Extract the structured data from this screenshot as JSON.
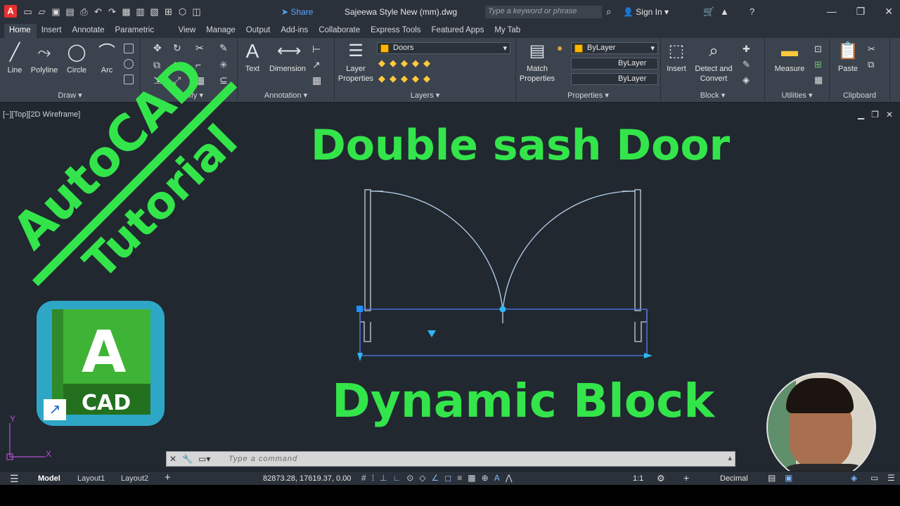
{
  "titlebar": {
    "app_logo": "A",
    "share_label": "Share",
    "document_title": "Sajeewa Style New (mm).dwg",
    "search_placeholder": "Type a keyword or phrase",
    "signin_label": "Sign In"
  },
  "ribbon_tabs": [
    "Home",
    "Insert",
    "Annotate",
    "Parametric",
    "View",
    "Manage",
    "Output",
    "Add-ins",
    "Collaborate",
    "Express Tools",
    "Featured Apps",
    "My Tab"
  ],
  "active_tab": "Home",
  "ribbon": {
    "draw": {
      "title": "Draw",
      "tools": [
        "Line",
        "Polyline",
        "Circle",
        "Arc"
      ]
    },
    "modify": {
      "title": "Modify"
    },
    "annotation": {
      "title": "Annotation",
      "tools": [
        "Text",
        "Dimension"
      ]
    },
    "layers": {
      "title": "Layers",
      "tool": "Layer Properties",
      "current_layer": "Doors"
    },
    "properties": {
      "title": "Properties",
      "tool": "Match Properties",
      "color": "ByLayer",
      "linetype": "ByLayer",
      "lineweight": "ByLayer"
    },
    "block": {
      "title": "Block",
      "tools": [
        "Insert",
        "Detect and Convert"
      ]
    },
    "utilities": {
      "title": "Utilities",
      "tool": "Measure"
    },
    "clipboard": {
      "title": "Clipboard",
      "tool": "Paste"
    }
  },
  "viewport": {
    "label": "[−][Top][2D Wireframe]",
    "heading": "Double sash Door",
    "subheading": "Dynamic Block",
    "watermark_line1": "AutoCAD",
    "watermark_line2": "Tutorial",
    "ucs_y": "Y",
    "ucs_x": "X"
  },
  "app_icon": {
    "letter": "A",
    "caption": "CAD"
  },
  "command_line": {
    "placeholder": "Type a command"
  },
  "status_bar": {
    "layout_tabs": [
      "Model",
      "Layout1",
      "Layout2"
    ],
    "coordinates": "82873.28, 17619.37, 0.00",
    "scale": "1:1",
    "units": "Decimal"
  },
  "colors": {
    "accent_green": "#33e54a",
    "ribbon_bg": "#3b434e",
    "canvas_bg": "#212830",
    "grip_blue": "#1e90ff"
  }
}
